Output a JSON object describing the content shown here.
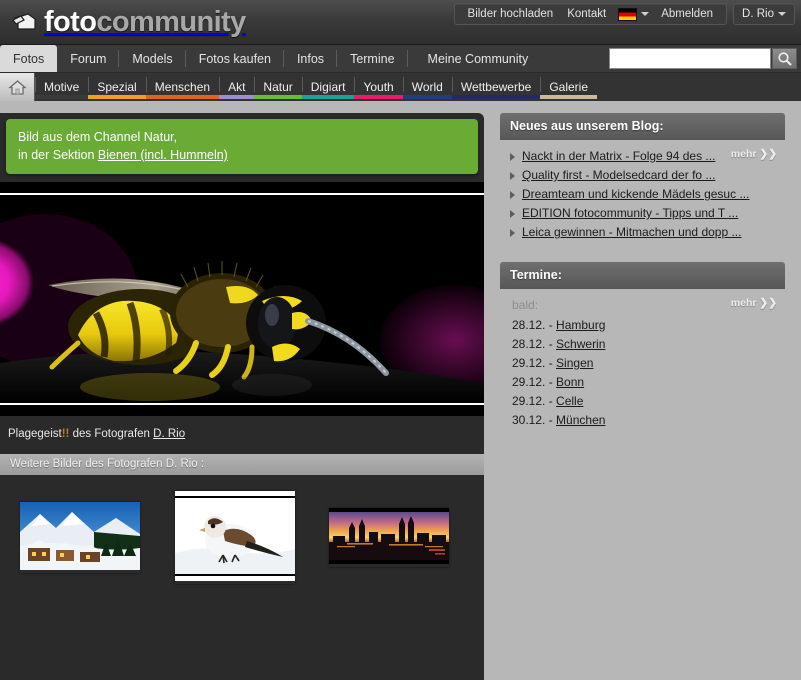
{
  "header": {
    "logo_foto": "foto",
    "logo_community": "community",
    "logo_icon": "camera-icon",
    "topnav": [
      {
        "label": "Bilder hochladen",
        "name": "upload-images-link"
      },
      {
        "label": "Kontakt",
        "name": "contact-link"
      }
    ],
    "flag": {
      "name": "german-flag-icon",
      "alt": "Deutsch"
    },
    "logout_label": "Abmelden",
    "user_label": "D. Rio"
  },
  "mainnav": {
    "items": [
      {
        "label": "Fotos",
        "active": true
      },
      {
        "label": "Forum",
        "active": false
      },
      {
        "label": "Models",
        "active": false
      },
      {
        "label": "Fotos kaufen",
        "active": false
      },
      {
        "label": "Infos",
        "active": false
      },
      {
        "label": "Termine",
        "active": false
      },
      {
        "label": "Meine Community",
        "active": false
      }
    ]
  },
  "search": {
    "value": "",
    "placeholder": "",
    "button_icon": "search-icon"
  },
  "subnav": {
    "home_icon": "home-icon",
    "items": [
      {
        "label": "Motive",
        "color": "#3a3a3a"
      },
      {
        "label": "Spezial",
        "color": "#f0a21c"
      },
      {
        "label": "Menschen",
        "color": "#e2651e"
      },
      {
        "label": "Akt",
        "color": "#9b8fd0"
      },
      {
        "label": "Natur",
        "color": "#6aba3c"
      },
      {
        "label": "Digiart",
        "color": "#15a39b"
      },
      {
        "label": "Youth",
        "color": "#f0186a"
      },
      {
        "label": "World",
        "color": "#1f3f7a"
      },
      {
        "label": "Wettbewerbe",
        "color": "#232a63"
      },
      {
        "label": "Galerie",
        "color": "#cdbb95"
      }
    ]
  },
  "banner": {
    "line1": "Bild aus dem Channel Natur,",
    "line2_prefix": "in der Sektion ",
    "line2_link": "Bienen (incl. Hummeln)",
    "color": "#6aab35"
  },
  "photo": {
    "title": "Plagegeist",
    "bang": "!!",
    "by_prefix": " des Fotografen ",
    "author": "D. Rio",
    "alt": "Makroaufnahme einer Wespe vor magentafarbenem Hintergrund"
  },
  "more_photos": {
    "header": "Weitere Bilder des Fotografen D. Rio :",
    "thumbs": [
      {
        "name": "thumb-alpine-village",
        "alt": "Alpendorf im Schnee"
      },
      {
        "name": "thumb-snow-bird",
        "alt": "Vogel im Schnee"
      },
      {
        "name": "thumb-city-skyline",
        "alt": "Stadtsilhouette bei Sonnenuntergang"
      }
    ]
  },
  "blog": {
    "title": "Neues aus unserem Blog:",
    "mehr": "mehr ❯❯",
    "items": [
      "Nackt in der Matrix - Folge 94 des ...",
      "Quality first - Modelsedcard der fo ...",
      "Dreamteam und kickende Mädels gesuc ...",
      "EDITION fotocommunity - Tipps und T ...",
      "Leica gewinnen - Mitmachen und dopp ..."
    ]
  },
  "termine": {
    "title": "Termine:",
    "mehr": "mehr ❯❯",
    "subtitle": "bald:",
    "items": [
      {
        "date": "28.12. -",
        "city": "Hamburg"
      },
      {
        "date": "28.12. -",
        "city": "Schwerin"
      },
      {
        "date": "29.12. -",
        "city": "Singen"
      },
      {
        "date": "29.12. -",
        "city": "Bonn"
      },
      {
        "date": "29.12. -",
        "city": "Celle"
      },
      {
        "date": "30.12. -",
        "city": "München"
      }
    ]
  }
}
